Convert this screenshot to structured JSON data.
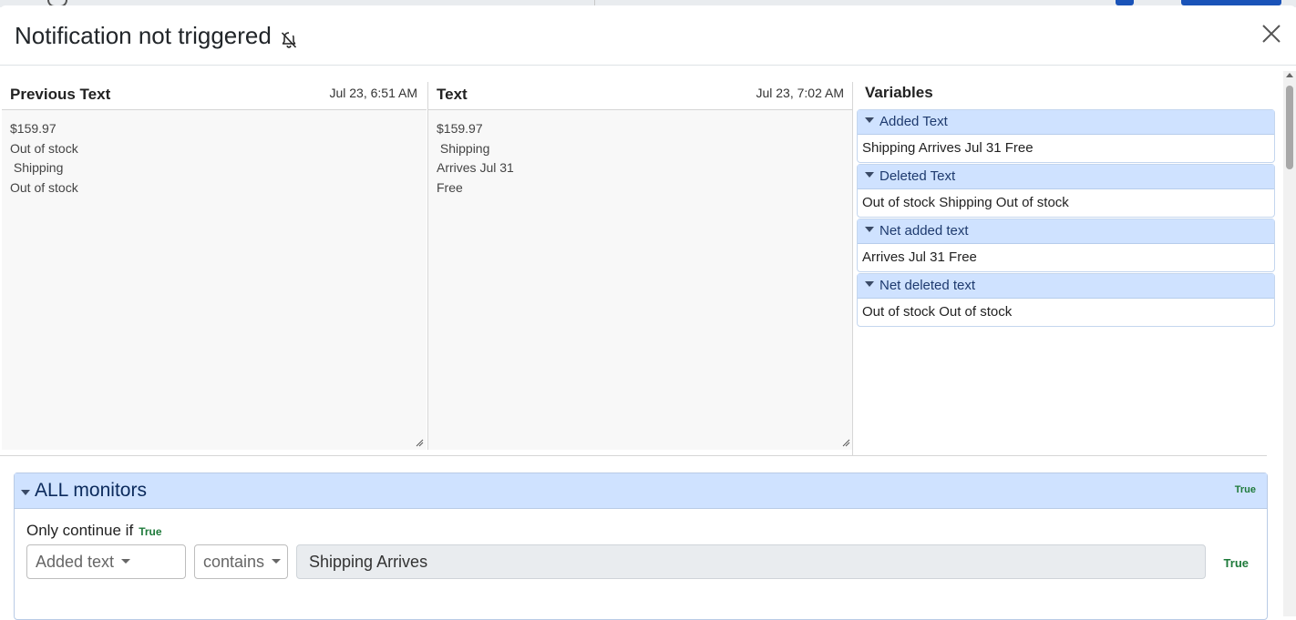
{
  "modal": {
    "title": "Notification not triggered",
    "title_icon": "bell-slash-icon",
    "close_icon": "close-icon"
  },
  "previous_pane": {
    "title": "Previous Text",
    "timestamp": "Jul 23, 6:51 AM",
    "content": "$159.97\nOut of stock\n Shipping\nOut of stock"
  },
  "text_pane": {
    "title": "Text",
    "timestamp": "Jul 23, 7:02 AM",
    "content": "$159.97\n Shipping\nArrives Jul 31\nFree"
  },
  "variables": {
    "title": "Variables",
    "items": [
      {
        "label": "Added Text",
        "value": "Shipping Arrives Jul 31 Free"
      },
      {
        "label": "Deleted Text",
        "value": "Out of stock Shipping Out of stock"
      },
      {
        "label": "Net added text",
        "value": "Arrives Jul 31 Free"
      },
      {
        "label": "Net deleted text",
        "value": "Out of stock Out of stock"
      }
    ]
  },
  "monitors": {
    "title": "ALL monitors",
    "status": "True",
    "condition": {
      "label": "Only continue if",
      "status": "True",
      "variable": "Added text",
      "operator": "contains",
      "value": "Shipping Arrives",
      "value_status": "True"
    }
  },
  "colors": {
    "accent_header": "#cfe2ff",
    "true_green": "#1e7a3a"
  }
}
